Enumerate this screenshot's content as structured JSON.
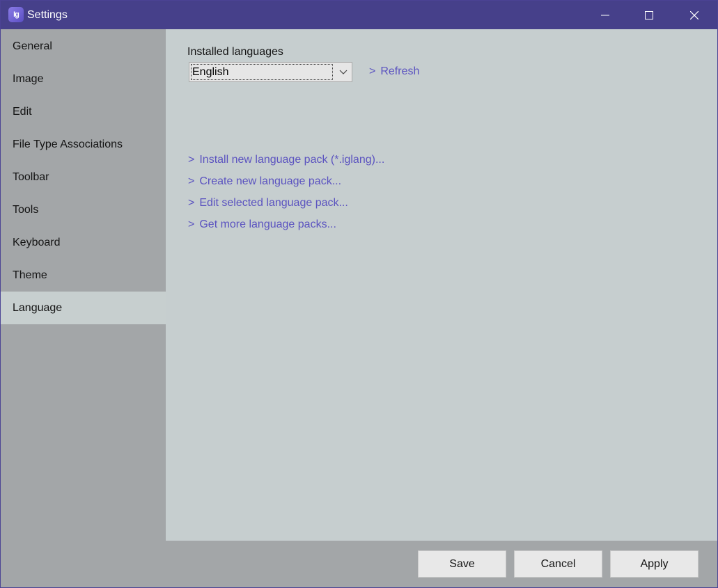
{
  "window": {
    "title": "Settings",
    "icon": "imageglass-app-icon",
    "icon_glyph": "Ig"
  },
  "colors": {
    "titlebar": "#46408a",
    "sidebar": "#a3a6a8",
    "content": "#c6cecf",
    "active_item": "#c7cfcf",
    "link": "#5b53c0"
  },
  "sidebar": {
    "items": [
      {
        "label": "General",
        "active": false
      },
      {
        "label": "Image",
        "active": false
      },
      {
        "label": "Edit",
        "active": false
      },
      {
        "label": "File Type Associations",
        "active": false
      },
      {
        "label": "Toolbar",
        "active": false
      },
      {
        "label": "Tools",
        "active": false
      },
      {
        "label": "Keyboard",
        "active": false
      },
      {
        "label": "Theme",
        "active": false
      },
      {
        "label": "Language",
        "active": true
      }
    ]
  },
  "language": {
    "installed_label": "Installed languages",
    "selected": "English",
    "refresh_label": "Refresh",
    "chevron": ">",
    "actions": [
      {
        "label": "Install new language pack (*.iglang)..."
      },
      {
        "label": "Create new language pack..."
      },
      {
        "label": "Edit selected language pack..."
      },
      {
        "label": "Get more language packs..."
      }
    ]
  },
  "footer": {
    "save_label": "Save",
    "cancel_label": "Cancel",
    "apply_label": "Apply"
  }
}
